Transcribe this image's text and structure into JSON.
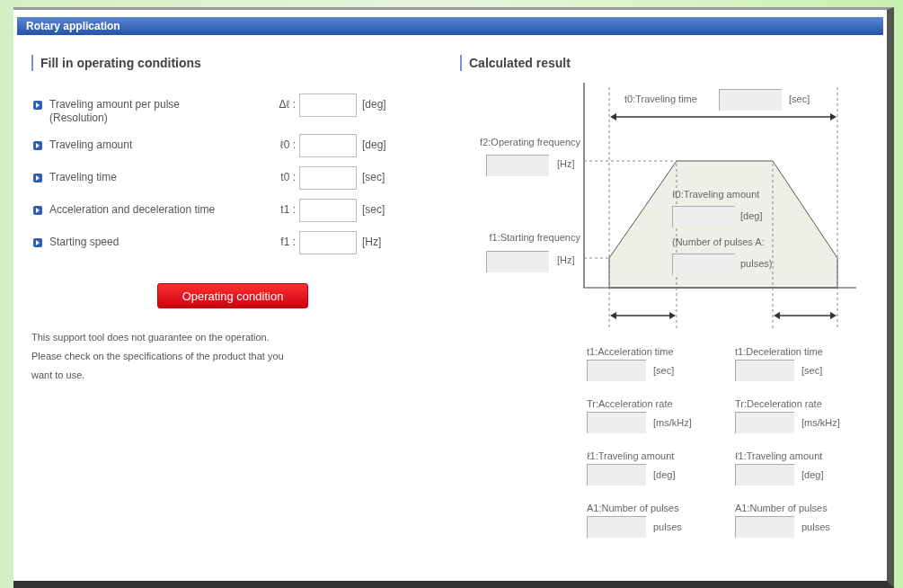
{
  "window": {
    "title": "Rotary application"
  },
  "conditions": {
    "heading": "Fill in operating conditions",
    "rows": [
      {
        "label": "Traveling amount per pulse\n(Resolution)",
        "symbol": "Δℓ :",
        "unit": "[deg]"
      },
      {
        "label": "Traveling amount",
        "symbol": "ℓ0 :",
        "unit": "[deg]"
      },
      {
        "label": "Traveling time",
        "symbol": "t0 :",
        "unit": "[sec]"
      },
      {
        "label": "Acceleration and deceleration time",
        "symbol": "t1 :",
        "unit": "[sec]"
      },
      {
        "label": "Starting speed",
        "symbol": "f1 :",
        "unit": "[Hz]"
      }
    ],
    "button": "Operating condition",
    "note": "This support tool does not guarantee on the operation. Please check on the specifications of the product that you want to use."
  },
  "result": {
    "heading": "Calculated result",
    "diagram": {
      "traveling_time": {
        "label": "t0:Traveling time",
        "unit": "[sec]"
      },
      "operating_frequency": {
        "label": "f2:Operating frequency",
        "unit": "[Hz]"
      },
      "starting_frequency": {
        "label": "f1:Starting frequency",
        "unit": "[Hz]"
      },
      "traveling_amount": {
        "label": "ℓ0:Traveling amount",
        "unit": "[deg]"
      },
      "pulses": {
        "label": "(Number of pulses A:",
        "unit": "pulses)"
      }
    },
    "details": [
      {
        "label": "t1:Acceleration time",
        "unit": "[sec]"
      },
      {
        "label": "t1:Deceleration time",
        "unit": "[sec]"
      },
      {
        "label": "Tr:Acceleration rate",
        "unit": "[ms/kHz]"
      },
      {
        "label": "Tr:Deceleration rate",
        "unit": "[ms/kHz]"
      },
      {
        "label": "ℓ1:Traveling amount",
        "unit": "[deg]"
      },
      {
        "label": "ℓ1:Traveling amount",
        "unit": "[deg]"
      },
      {
        "label": "A1:Number of pulses",
        "unit": "pulses"
      },
      {
        "label": "A1:Number of pulses",
        "unit": "pulses"
      }
    ]
  }
}
